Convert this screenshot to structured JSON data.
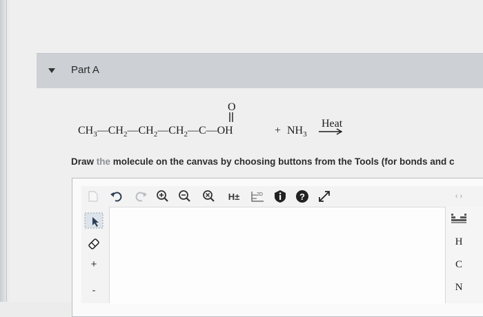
{
  "part": {
    "title": "Part A"
  },
  "reaction": {
    "carbonyl_o": "O",
    "chain": [
      "CH",
      "3",
      "—CH",
      "2",
      "—CH",
      "2",
      "—CH",
      "2",
      "—C—OH"
    ],
    "plus": "+",
    "reagent": "NH",
    "reagent_sub": "3",
    "arrow_label": "Heat"
  },
  "instructions": {
    "before": "Draw ",
    "faded": "the",
    "after": " molecule on the canvas by choosing buttons from the Tools (for bonds and c"
  },
  "toolbar": {
    "h_toggle_label": "H±",
    "view_2d_label": "2D"
  },
  "left_tools": {
    "plus_label": "+",
    "minus_label": "-"
  },
  "right_tools": {
    "elements": [
      "H",
      "C",
      "N"
    ],
    "arrows_label": "‹ ›"
  },
  "colors": {
    "header_bg": "#cdd0d4",
    "help_icon_bg": "#222222"
  }
}
